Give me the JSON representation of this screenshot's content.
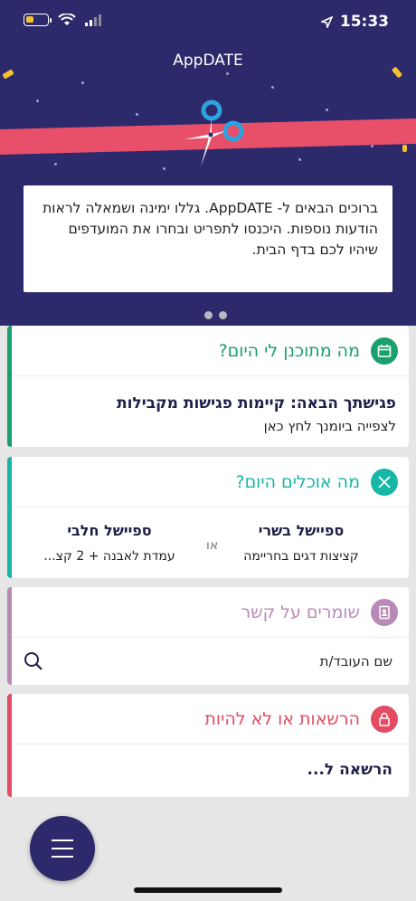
{
  "status": {
    "time": "15:33"
  },
  "app": {
    "title": "AppDATE"
  },
  "welcome": {
    "text": "ברוכים הבאים ל- AppDATE. גללו ימינה ושמאלה לראות הודעות נוספות. היכנסו לתפריט ובחרו את המועדפים שיהיו לכם בדף הבית."
  },
  "pager": {
    "count": 3,
    "active_index": 0
  },
  "schedule": {
    "title": "מה מתוכנן לי היום?",
    "next_meeting": "פגישתך הבאה: קיימות פגישות מקבילות",
    "hint": "לצפייה ביומנך לחץ כאן",
    "accent": "#1aa06d"
  },
  "food": {
    "title": "מה אוכלים היום?",
    "meat_label": "ספיישל בשרי",
    "meat_desc": "קציצות דגים בחריימה",
    "or": "או",
    "dairy_label": "ספיישל חלבי",
    "dairy_desc": "עמדת לאבנה + 2 קצ...",
    "accent": "#17b6a5"
  },
  "contacts": {
    "title": "שומרים על קשר",
    "search_placeholder": "שם העובד/ת",
    "accent": "#b98ab6"
  },
  "permissions": {
    "title": "הרשאות או לא להיות",
    "item": "הרשאה ל...",
    "accent": "#e34c63"
  },
  "colors": {
    "header_bg": "#2d2a6b",
    "ribbon": "#e8506a",
    "confetti": "#f2c230"
  }
}
